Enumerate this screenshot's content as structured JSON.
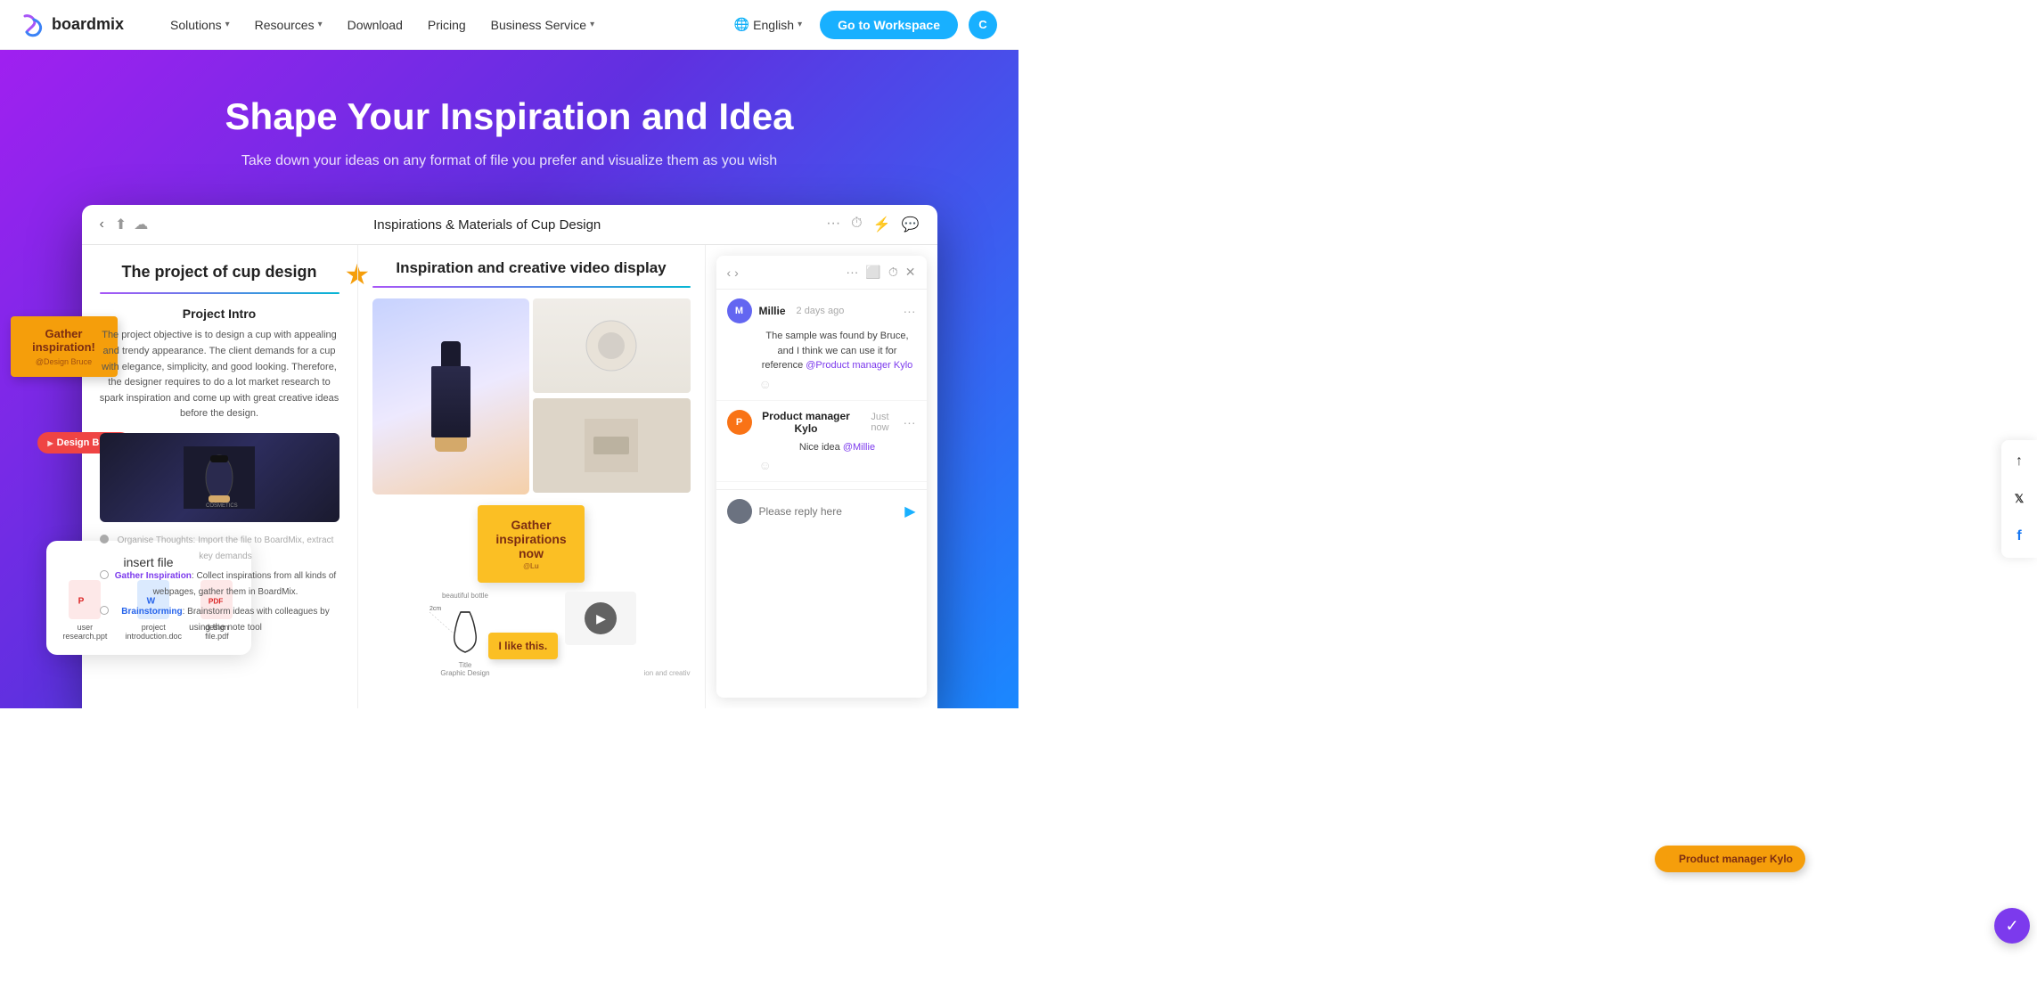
{
  "header": {
    "logo_text": "boardmix",
    "nav_items": [
      {
        "label": "Solutions",
        "has_dropdown": true
      },
      {
        "label": "Resources",
        "has_dropdown": true
      },
      {
        "label": "Download",
        "has_dropdown": false
      },
      {
        "label": "Pricing",
        "has_dropdown": false
      },
      {
        "label": "Business Service",
        "has_dropdown": true
      }
    ],
    "lang_icon": "🌐",
    "lang_label": "English",
    "go_workspace_label": "Go to Workspace",
    "user_initial": "C"
  },
  "hero": {
    "title": "Shape Your Inspiration and Idea",
    "subtitle": "Take down your ideas on any format of file you prefer and visualize them as you wish"
  },
  "mockup": {
    "titlebar": {
      "title": "Inspirations & Materials of Cup Design",
      "back_label": "‹",
      "upload_icon": "⬆",
      "cloud_icon": "☁",
      "more_icon": "···",
      "timer_icon": "⏱",
      "share_icon": "✈",
      "comment_icon": "💬"
    },
    "left_panel": {
      "doc_title": "The project of cup design",
      "section_title": "Project Intro",
      "body_text": "The project objective is to design a cup with appealing and trendy appearance. The client demands for a cup with elegance, simplicity, and good looking. Therefore, the designer requires to do a lot market research to spark inspiration and come up with great creative ideas before the design.",
      "tasks": [
        {
          "label": "Organise Thoughts: Import the file to BoardMix, extract key demands",
          "done": true
        },
        {
          "label": "Gather Inspiration: Collect inspirations from all kinds of webpages, gather them in BoardMix.",
          "done": false,
          "highlight": "Gather Inspiration"
        },
        {
          "label": "Brainstorming: Brainstorm ideas with colleagues by using the note tool",
          "done": false,
          "highlight": "Brainstorming"
        }
      ]
    },
    "gather_sticky": {
      "main": "Gather inspiration!",
      "sub": "@Design Bruce"
    },
    "design_bruce_tag": "Design Bruce",
    "insert_file": {
      "title": "insert file",
      "files": [
        {
          "name": "user research.ppt",
          "type": "ppt"
        },
        {
          "name": "project introduction.doc",
          "type": "doc"
        },
        {
          "name": "design file.pdf",
          "type": "pdf"
        }
      ]
    },
    "middle_panel": {
      "title": "Inspiration and creative video display"
    },
    "gather_now": {
      "main": "Gather inspirations now",
      "sub": "@Lu"
    },
    "like_this": "I like this.",
    "comments": {
      "user1": {
        "name": "Millie",
        "time": "2 days ago",
        "text": "The sample was found by Bruce, and I think we can use it for reference @Product manager Kylo",
        "initial": "M"
      },
      "user2": {
        "name": "Product manager Kylo",
        "time": "Just now",
        "text": "Nice idea @Millie",
        "initial": "P"
      },
      "reply_placeholder": "Please reply here"
    },
    "product_manager_tag": "Product manager Kylo",
    "bottom_right": {
      "label": "ion and creativ"
    }
  },
  "social": {
    "up_icon": "↑",
    "twitter_icon": "𝕏",
    "facebook_icon": "f"
  },
  "sketch": {
    "title_label": "Title",
    "graphic_label": "Graphic Design",
    "beautiful_label": "beautiful bottle"
  }
}
